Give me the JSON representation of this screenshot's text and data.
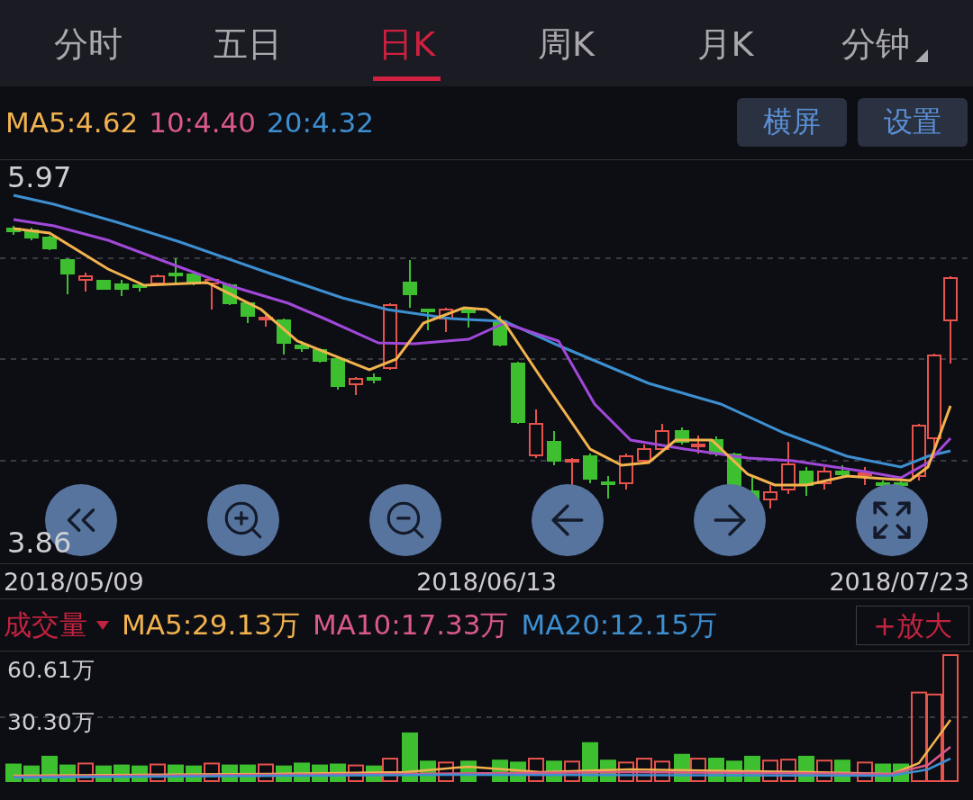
{
  "tabs": [
    {
      "label": "分时",
      "selected": false
    },
    {
      "label": "五日",
      "selected": false
    },
    {
      "label": "日K",
      "selected": true
    },
    {
      "label": "周K",
      "selected": false
    },
    {
      "label": "月K",
      "selected": false
    },
    {
      "label": "分钟",
      "selected": false,
      "dropdown": true
    }
  ],
  "ma_legend": [
    {
      "text": "MA5:4.62",
      "color": "#f2b34e"
    },
    {
      "text": "10:4.40",
      "color": "#d9598a"
    },
    {
      "text": "20:4.32",
      "color": "#3d8fd0"
    }
  ],
  "buttons": [
    "横屏",
    "设置"
  ],
  "price_chart": {
    "max_label": "5.97",
    "min_label": "3.86"
  },
  "dates": [
    "2018/05/09",
    "2018/06/13",
    "2018/07/23"
  ],
  "volume": {
    "title": "成交量",
    "dropdown": true,
    "ma_legend": [
      {
        "text": "MA5:29.13万",
        "color": "#f2b34e"
      },
      {
        "text": "MA10:17.33万",
        "color": "#d9598a"
      },
      {
        "text": "MA20:12.15万",
        "color": "#3d8fd0"
      }
    ],
    "zoom_button": "+放大",
    "max_label": "60.61万",
    "mid_label": "30.30万"
  }
}
